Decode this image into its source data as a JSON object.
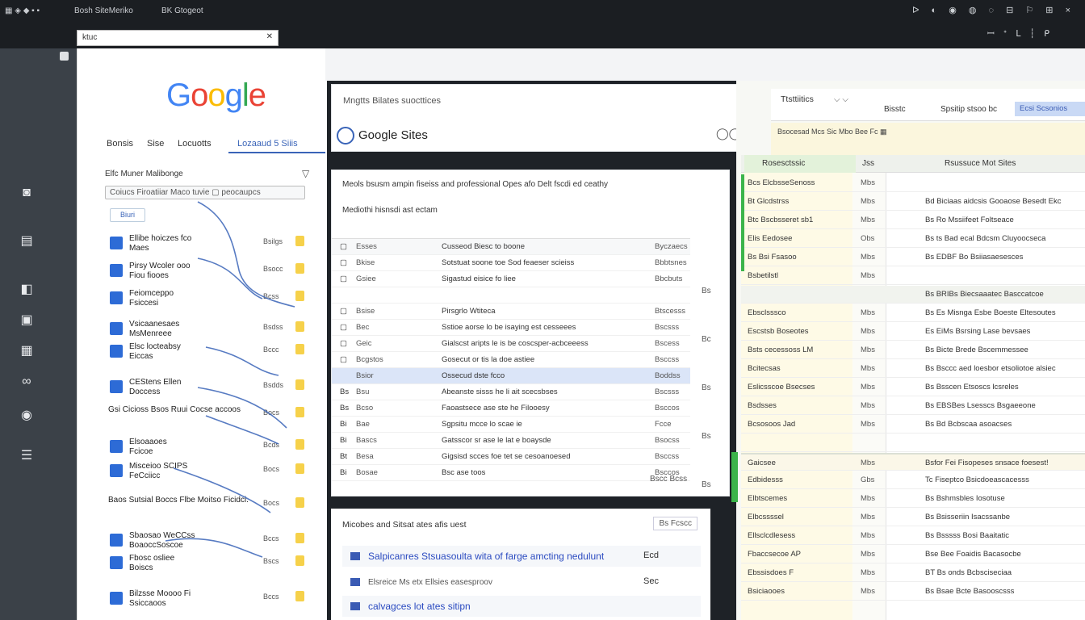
{
  "browser": {
    "tabs": [
      {
        "label": "Bosh SiteMeriko"
      },
      {
        "label": "BK Gtogeot"
      }
    ],
    "url": "ktuc",
    "sys_icons": "ᐅ ◐ ◉ ◍ ◌ ⊟ ⚐ ⊞ ×",
    "sys_icons2": "ꟷ ᐩ ᒪ ┆ ᑭ"
  },
  "left_rail": {
    "icons": [
      "chat-icon",
      "file-icon",
      "image-icon",
      "drive-icon",
      "grid-icon",
      "link-icon",
      "radio-icon",
      "list-icon"
    ]
  },
  "panel1": {
    "logo": [
      "G",
      "o",
      "o",
      "g",
      "l",
      "e"
    ],
    "logo_colors": [
      "#4285F4",
      "#EA4335",
      "#FBBC05",
      "#4285F4",
      "#34A853",
      "#EA4335"
    ],
    "tabs": [
      "Bonsis",
      "Sise",
      "Locuotts",
      "Lozaaud 5 Siiis"
    ],
    "filter_label": "Elfc Muner  Malibonge",
    "search_placeholder": "Coiucs Firoatiiar  Maco tuvie  ▢  peocaupcs",
    "chip": "Biuri",
    "items": [
      {
        "label": "Ellibe hoiczes fco\nMaes",
        "small": "Bsilgs"
      },
      {
        "label": "Pirsy Wcoler ooo\nFiou fiooes",
        "small": "Bsocc"
      },
      {
        "label": "Feiomceppo\nFsiccesi",
        "small": "Bcss"
      },
      {
        "label": "Vsicaanesaes\nMsMenreee",
        "small": "Bsdss"
      },
      {
        "label": "Elsc locteabsy\nEiccas",
        "small": "Bccc"
      },
      {
        "label": "CEStens  Ellen\nDoccess",
        "small": "Bsdds"
      },
      {
        "label": "Gsi  Cicioss Bsos\nRuui Cocse accoos",
        "small": "Bocs"
      },
      {
        "label": "Elsoaaoes\nFcicoe",
        "small": "Bcds"
      },
      {
        "label": "Misceioo SCIPS\nFeCciicc",
        "small": "Bocs"
      },
      {
        "label": "Baos Sutsial Boccs\nFlbe Moitso Ficidci.",
        "small": "Bocs"
      },
      {
        "label": "Sbaosao WeCCss\nBoaoccSoscoe",
        "small": "Bccs"
      },
      {
        "label": "Fbosc osliee\nBoiscs",
        "small": "Bscs"
      },
      {
        "label": "Bilzsse Moooo  Fi\nSsiccaoos",
        "small": "Bccs"
      }
    ]
  },
  "panel2": {
    "header_sub": "Mngtts Bilates suocttices",
    "title": "Google Sites",
    "header_icon": "fß",
    "header_icon2": "◯◯",
    "desc1": "Meols bsusm ampin fiseiss and professional Opes afo Delt fscdi ed ceathy",
    "desc2": "Mediothi hisnsdi ast ectam",
    "rows": [
      {
        "c1": "▢",
        "c2": "Esses",
        "c3": "Cusseod Biesc to boone",
        "c4": "Byczaecs",
        "head": true
      },
      {
        "c1": "▢",
        "c2": "Bkise",
        "c3": "Sotstuat soone toe Sod feaeser scieiss",
        "c4": "Bbbtsnes"
      },
      {
        "c1": "▢",
        "c2": "Gsiee",
        "c3": "Sigastud eisice fo liee",
        "c4": "Bbcbuts"
      },
      {
        "c1": "",
        "c2": "",
        "c3": "",
        "c4": ""
      },
      {
        "c1": "▢",
        "c2": "Bsise",
        "c3": "Pirsgrlo Wtiteca",
        "c4": "Btscesss"
      },
      {
        "c1": "▢",
        "c2": "Bec",
        "c3": "Sstioe aorse lo be isaying est cesseees",
        "c4": "Bscsss"
      },
      {
        "c1": "▢",
        "c2": "Geic",
        "c3": "Gialscst aripts le is be coscsper-acbceeess",
        "c4": "Bscess"
      },
      {
        "c1": "▢",
        "c2": "Bcgstos",
        "c3": "Gosecut or tis la doe astiee",
        "c4": "Bsccss"
      },
      {
        "c1": "",
        "c2": "Bsior",
        "c3": "Ossecud dste fcco",
        "c4": "Boddss",
        "sel": true
      },
      {
        "c1": "Bs",
        "c2": "Bsu",
        "c3": "Abeanste sisss he li ait scecsbses",
        "c4": "Bscsss"
      },
      {
        "c1": "Bs",
        "c2": "Bcso",
        "c3": "Faoastsece ase ste he Filooesy",
        "c4": "Bsccos"
      },
      {
        "c1": "Bi",
        "c2": "Bae",
        "c3": "Sgpsitu mcce lo scae ie",
        "c4": "Fcce"
      },
      {
        "c1": "Bi",
        "c2": "Bascs",
        "c3": "Gatsscor sr ase le lat e boaysde",
        "c4": "Bsocss"
      },
      {
        "c1": "Bt",
        "c2": "Besa",
        "c3": "Gigsisd scces foe tet se cesoanoesed",
        "c4": "Bsccss"
      },
      {
        "c1": "Bi",
        "c2": "Bosae",
        "c3": "Bsc ase toos",
        "c4": "Bsccos"
      }
    ],
    "footer": "Bscc  Bcss",
    "side": [
      "Bs",
      "Bc",
      "Bs",
      "Bs",
      "Bs"
    ],
    "related_header": "Micobes and Sitsat ates afis uest",
    "related_button": "Bs Fcscc",
    "related": [
      {
        "title": "Salpicanres Stsuasoulta wita of farge amcting nedulunt",
        "right": "Ecd"
      },
      {
        "title": "Elsreice Ms etx Ellsies  easesproov",
        "right": "Sec",
        "gray": true
      },
      {
        "title": "calvagces lot ates sitipn",
        "right": ""
      }
    ]
  },
  "panel3": {
    "dropdown": "Ttsttiitics",
    "dropdown_arrow": "⌵  ⌵",
    "tab2": "Bisstc",
    "tab3": "Spsitip stsoo bc",
    "tab4": "Ecsi Scsonios",
    "strip": "Bsocesad Mcs Sic  Mbo Bee  Fc  ▦",
    "head": [
      "Rosesctssic",
      "Jss",
      "Rsussuce Mot Sites"
    ],
    "rows": [
      {
        "c1": "Bcs ElcbsseSenoss",
        "c2": "Mbs",
        "c3": ""
      },
      {
        "c1": "Bt Glcdstrss",
        "c2": "Mbs",
        "c3": "Bd Biciaas aidcsis  Gooaose Besedt Ekc"
      },
      {
        "c1": "Btc Bscbsseret sb1",
        "c2": "Mbs",
        "c3": "Bs Ro Mssiifeet Foltseace"
      },
      {
        "c1": "Elis Eedosee",
        "c2": "Obs",
        "c3": "Bs ts Bad ecal Bdcsm Cluyoocseca"
      },
      {
        "c1": "Bs Bsi Fsasoo",
        "c2": "Mbs",
        "c3": "Bs EDBF Bo Bsiiasaesesces"
      },
      {
        "c1": "Bsbetilstl",
        "c2": "Mbs",
        "c3": ""
      },
      {
        "c1": "",
        "c2": "",
        "c3": "Bs BRIBs Biecsaaatec Basccatcoe",
        "sel": true
      },
      {
        "c1": "Ebsclsssco",
        "c2": "Mbs",
        "c3": "Bs Es Misnga Esbe Boeste Eltesoutes"
      },
      {
        "c1": "Escstsb Boseotes",
        "c2": "Mbs",
        "c3": "Es EiMs Bsrsing Lase bevsaes"
      },
      {
        "c1": "Bsts cecessoss LM",
        "c2": "Mbs",
        "c3": "Bs Bicte Brede Bscemmessee"
      },
      {
        "c1": "Bcitecsas",
        "c2": "Mbs",
        "c3": "Bs Bsccc aed loesbor etsoliotoe alsiec"
      },
      {
        "c1": "Eslicsscoe Bsecses",
        "c2": "Mbs",
        "c3": "Bs Bsscen Etsoscs lcsreles"
      },
      {
        "c1": "Bsdsses",
        "c2": "Mbs",
        "c3": "Bs EBSBes Lsesscs Bsgaeeone"
      },
      {
        "c1": "Bcsosoos Jad",
        "c2": "Mbs",
        "c3": "Bs Bd Bcbscaa asoacses"
      },
      {
        "c1": "",
        "c2": "",
        "c3": ""
      },
      {
        "c1": "Gaicsee",
        "c2": "Mbs",
        "c3": "Bsfor Fei Fisopeses snsace foesest!",
        "sec": true
      },
      {
        "c1": "Edbidesss",
        "c2": "Gbs",
        "c3": "Tc Fiseptco Bsicdoeascacesss"
      },
      {
        "c1": "Elbtscemes",
        "c2": "Mbs",
        "c3": "Bs Bshmsbles Iosotuse"
      },
      {
        "c1": "Elbcssssel",
        "c2": "Mbs",
        "c3": "Bs Bsisseriin Isacssanbe"
      },
      {
        "c1": "Ellsclcdlesess",
        "c2": "Mbs",
        "c3": "Bs Bsssss Bosi Baaitatic"
      },
      {
        "c1": "Fbaccsecoe AP",
        "c2": "Mbs",
        "c3": "Bse Bee Foaidis Bacasocbe"
      },
      {
        "c1": "Ebssisdoes F",
        "c2": "Mbs",
        "c3": "BT Bs onds Bcbsciseciaa"
      },
      {
        "c1": "Bsiciaooes",
        "c2": "Mbs",
        "c3": "Bs Bsae Bcte Basooscsss"
      }
    ]
  }
}
